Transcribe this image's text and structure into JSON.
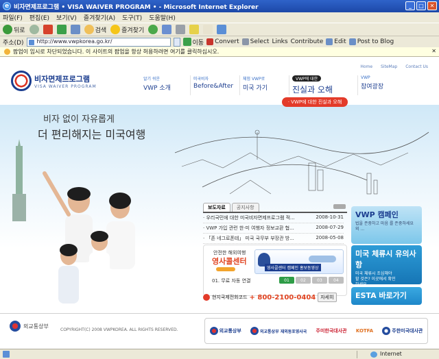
{
  "window": {
    "title": "비자면제프로그램 • VISA WAIVER PROGRAM • - Microsoft Internet Explorer"
  },
  "menu": [
    "파일(F)",
    "편집(E)",
    "보기(V)",
    "즐겨찾기(A)",
    "도구(T)",
    "도움말(H)"
  ],
  "toolbar": {
    "back": "뒤로",
    "search": "검색",
    "favorites": "즐겨찾기",
    "convert": "Convert",
    "select": "Select",
    "links": "Links",
    "contribute": "Contribute",
    "edit": "Edit",
    "post": "Post to Blog"
  },
  "address": {
    "label": "주소(D)",
    "url": "http://www.vwpkorea.go.kr/",
    "go": "이동"
  },
  "infobar": {
    "text": "팝업이 임시로 차단되었습니다. 이 사이트의 팝업을 항상 허용하려면 여기를 클릭하십시오."
  },
  "site": {
    "logo_title": "비자면제프로그램",
    "logo_sub": "VISA WAIVER PROGRAM",
    "toplinks": [
      "Home",
      "SiteMap",
      "Contact Us"
    ],
    "nav": [
      {
        "small": "알기 쉬운",
        "big": "VWP 소개"
      },
      {
        "small": "미국비자",
        "big": "Before&After"
      },
      {
        "small": "체험 VWP로",
        "big": "미국 가기"
      },
      {
        "small": "VWP에 대한",
        "big": "진실과 오해"
      },
      {
        "small": "VWP",
        "big": "참여광장"
      }
    ],
    "pill": "· VWP에 대한 진실과 오해",
    "tagline1": "비자 없이 자유롭게",
    "tagline2": "더 편리해지는 미국여행",
    "news": {
      "tabs": [
        "보도자료",
        "공지사항"
      ],
      "rows": [
        {
          "title": "· 우리국민에 대한 미국비자면제프로그램 적...",
          "date": "2008-10-31"
        },
        {
          "title": "· VWP 가입 관련 한·미 여행자 정보교환 협...",
          "date": "2008-07-29"
        },
        {
          "title": "· 「존 네그로폰테」 미국 국무부 부장관 방...",
          "date": "2008-05-08"
        }
      ]
    },
    "callcenter": {
      "small": "안전한 해외여행",
      "big": "영사콜센터",
      "banner": "영사콜센터 캠페인 홍보동영상",
      "line": "01. 무료 자동 연결",
      "nums": [
        "01",
        "02",
        "03",
        "04"
      ],
      "phone_label": "현지국제전화코드",
      "phone": "+ 800-2100-0404",
      "phone_btn": "자세히"
    },
    "side": [
      {
        "title": "VWP 캠페인",
        "desc": "법을 존중하고 마음 를 존중하세요 외 ..."
      },
      {
        "title": "미국 체류시 유의사항",
        "desc": "미국 체류시 조심해야 할 것은? 이곳에서 확인하세요."
      },
      {
        "title": "ESTA 바로가기",
        "desc": ""
      }
    ],
    "footer": {
      "mofa": "외교통상부",
      "copyright": "COPYRIGHT(C) 2008 VWPKOREA. ALL RIGHTS RESERVED.",
      "partners": [
        "외교통상부",
        "외교통상부 재외동포영사국",
        "주미한국대사관",
        "KOTFA",
        "주한미국대사관"
      ]
    }
  },
  "status": {
    "zone": "Internet"
  }
}
